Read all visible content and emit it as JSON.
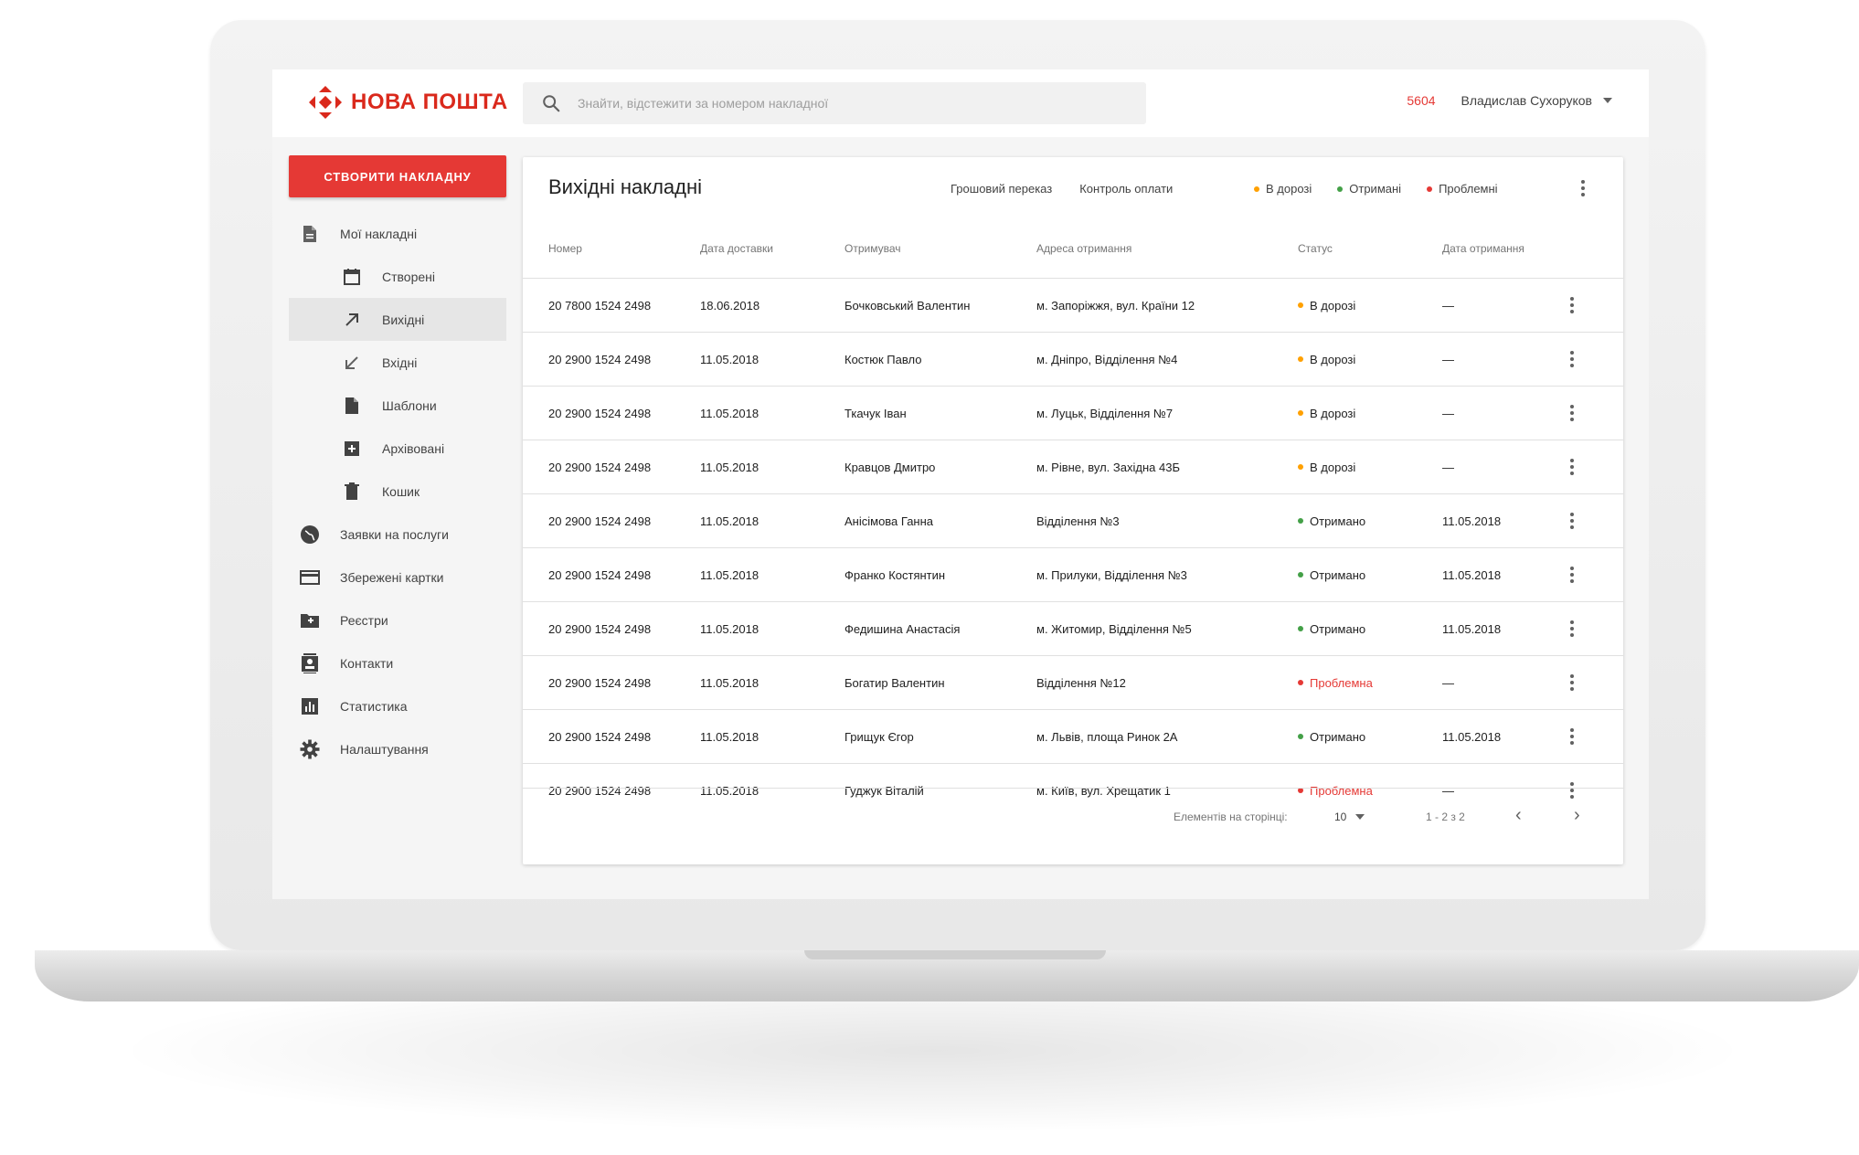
{
  "brand": {
    "name": "НОВА ПОШТА",
    "color": "#da291c"
  },
  "search": {
    "placeholder": "Знайти, відстежити за номером накладної"
  },
  "header": {
    "code": "5604",
    "user": "Владислав Сухоруков"
  },
  "sidebar": {
    "create_label": "СТВОРИТИ НАКЛАДНУ",
    "items": [
      {
        "label": "Мої накладні",
        "icon": "document-icon",
        "level": "top"
      },
      {
        "label": "Створені",
        "icon": "calendar-icon",
        "level": "sub"
      },
      {
        "label": "Вихідні",
        "icon": "arrow-up-right-icon",
        "level": "sub",
        "active": true
      },
      {
        "label": "Вхідні",
        "icon": "arrow-down-left-icon",
        "level": "sub"
      },
      {
        "label": "Шаблони",
        "icon": "file-icon",
        "level": "sub"
      },
      {
        "label": "Архівовані",
        "icon": "archive-icon",
        "level": "sub"
      },
      {
        "label": "Кошик",
        "icon": "trash-icon",
        "level": "sub"
      },
      {
        "label": "Заявки на послуги",
        "icon": "globe-icon",
        "level": "top"
      },
      {
        "label": "Збережені картки",
        "icon": "credit-card-icon",
        "level": "top"
      },
      {
        "label": "Реєстри",
        "icon": "folder-icon",
        "level": "top"
      },
      {
        "label": "Контакти",
        "icon": "contacts-icon",
        "level": "top"
      },
      {
        "label": "Статистика",
        "icon": "chart-icon",
        "level": "top"
      },
      {
        "label": "Налаштування",
        "icon": "gear-icon",
        "level": "top"
      }
    ]
  },
  "panel": {
    "title": "Вихідні накладні",
    "links": [
      "Грошовий переказ",
      "Контроль оплати"
    ],
    "legend": [
      {
        "label": "В дорозі",
        "color": "#ffa000"
      },
      {
        "label": "Отримані",
        "color": "#43a047"
      },
      {
        "label": "Проблемні",
        "color": "#e53935"
      }
    ]
  },
  "table": {
    "headers": [
      "Номер",
      "Дата доставки",
      "Отримувач",
      "Адреса отримання",
      "Статус",
      "Дата отримання"
    ],
    "rows": [
      [
        "20 7800 1524 2498",
        "18.06.2018",
        "Бочковський Валентин",
        "м. Запоріжжя, вул. Країни 12",
        "В дорозі",
        "—"
      ],
      [
        "20 2900 1524 2498",
        "11.05.2018",
        "Костюк Павло",
        "м. Дніпро, Відділення №4",
        "В дорозі",
        "—"
      ],
      [
        "20 2900 1524 2498",
        "11.05.2018",
        "Ткачук Іван",
        "м. Луцьк, Відділення №7",
        "В дорозі",
        "—"
      ],
      [
        "20 2900 1524 2498",
        "11.05.2018",
        "Кравцов Дмитро",
        "м. Рівне, вул. Західна 43Б",
        "В дорозі",
        "—"
      ],
      [
        "20 2900 1524 2498",
        "11.05.2018",
        "Анісімова Ганна",
        "Відділення №3",
        "Отримано",
        "11.05.2018"
      ],
      [
        "20 2900 1524 2498",
        "11.05.2018",
        "Франко Костянтин",
        "м. Прилуки, Відділення №3",
        "Отримано",
        "11.05.2018"
      ],
      [
        "20 2900 1524 2498",
        "11.05.2018",
        "Федишина Анастасія",
        "м. Житомир, Відділення №5",
        "Отримано",
        "11.05.2018"
      ],
      [
        "20 2900 1524 2498",
        "11.05.2018",
        "Богатир Валентин",
        "Відділення №12",
        "Проблемна",
        "—"
      ],
      [
        "20 2900 1524 2498",
        "11.05.2018",
        "Грищук Єгор",
        "м. Львів, площа Ринок 2А",
        "Отримано",
        "11.05.2018"
      ],
      [
        "20 2900 1524 2498",
        "11.05.2018",
        "Гуджук Віталій",
        "м. Київ, вул. Хрещатик 1",
        "Проблемна",
        "—"
      ]
    ],
    "status_colors": {
      "В дорозі": "#ffa000",
      "Отримано": "#43a047",
      "Проблемна": "#e53935"
    }
  },
  "pager": {
    "per_page_label": "Елементів на сторінці:",
    "per_page": "10",
    "range": "1 - 2 з 2",
    "prev": "‹",
    "next": "›"
  }
}
